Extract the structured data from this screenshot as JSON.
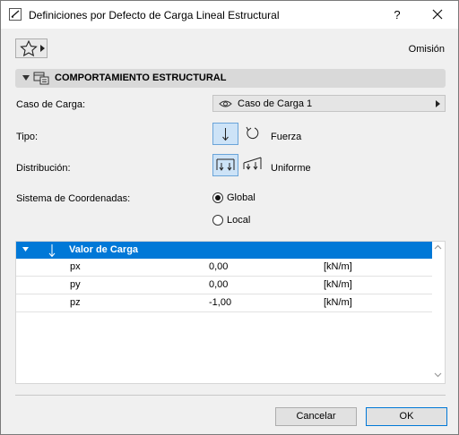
{
  "window": {
    "title": "Definiciones por Defecto de Carga Lineal Estructural",
    "help_label": "?"
  },
  "toolbar": {
    "favorites_icon": "star-icon",
    "preset_label": "Omisión"
  },
  "panel": {
    "title": "COMPORTAMIENTO ESTRUCTURAL"
  },
  "form": {
    "load_case_label": "Caso de Carga:",
    "load_case_value": "Caso de Carga 1",
    "type_label": "Tipo:",
    "type_value": "Fuerza",
    "distribution_label": "Distribución:",
    "distribution_value": "Uniforme",
    "coord_label": "Sistema de Coordenadas:",
    "coord_options": [
      "Global",
      "Local"
    ],
    "coord_selected": "Global"
  },
  "table": {
    "header": "Valor de Carga",
    "rows": [
      {
        "name": "px",
        "value": "0,00",
        "unit": "[kN/m]"
      },
      {
        "name": "py",
        "value": "0,00",
        "unit": "[kN/m]"
      },
      {
        "name": "pz",
        "value": "-1,00",
        "unit": "[kN/m]"
      }
    ]
  },
  "footer": {
    "cancel_label": "Cancelar",
    "ok_label": "OK"
  },
  "colors": {
    "accent": "#0078d7",
    "selected_bg": "#cde3f7"
  }
}
